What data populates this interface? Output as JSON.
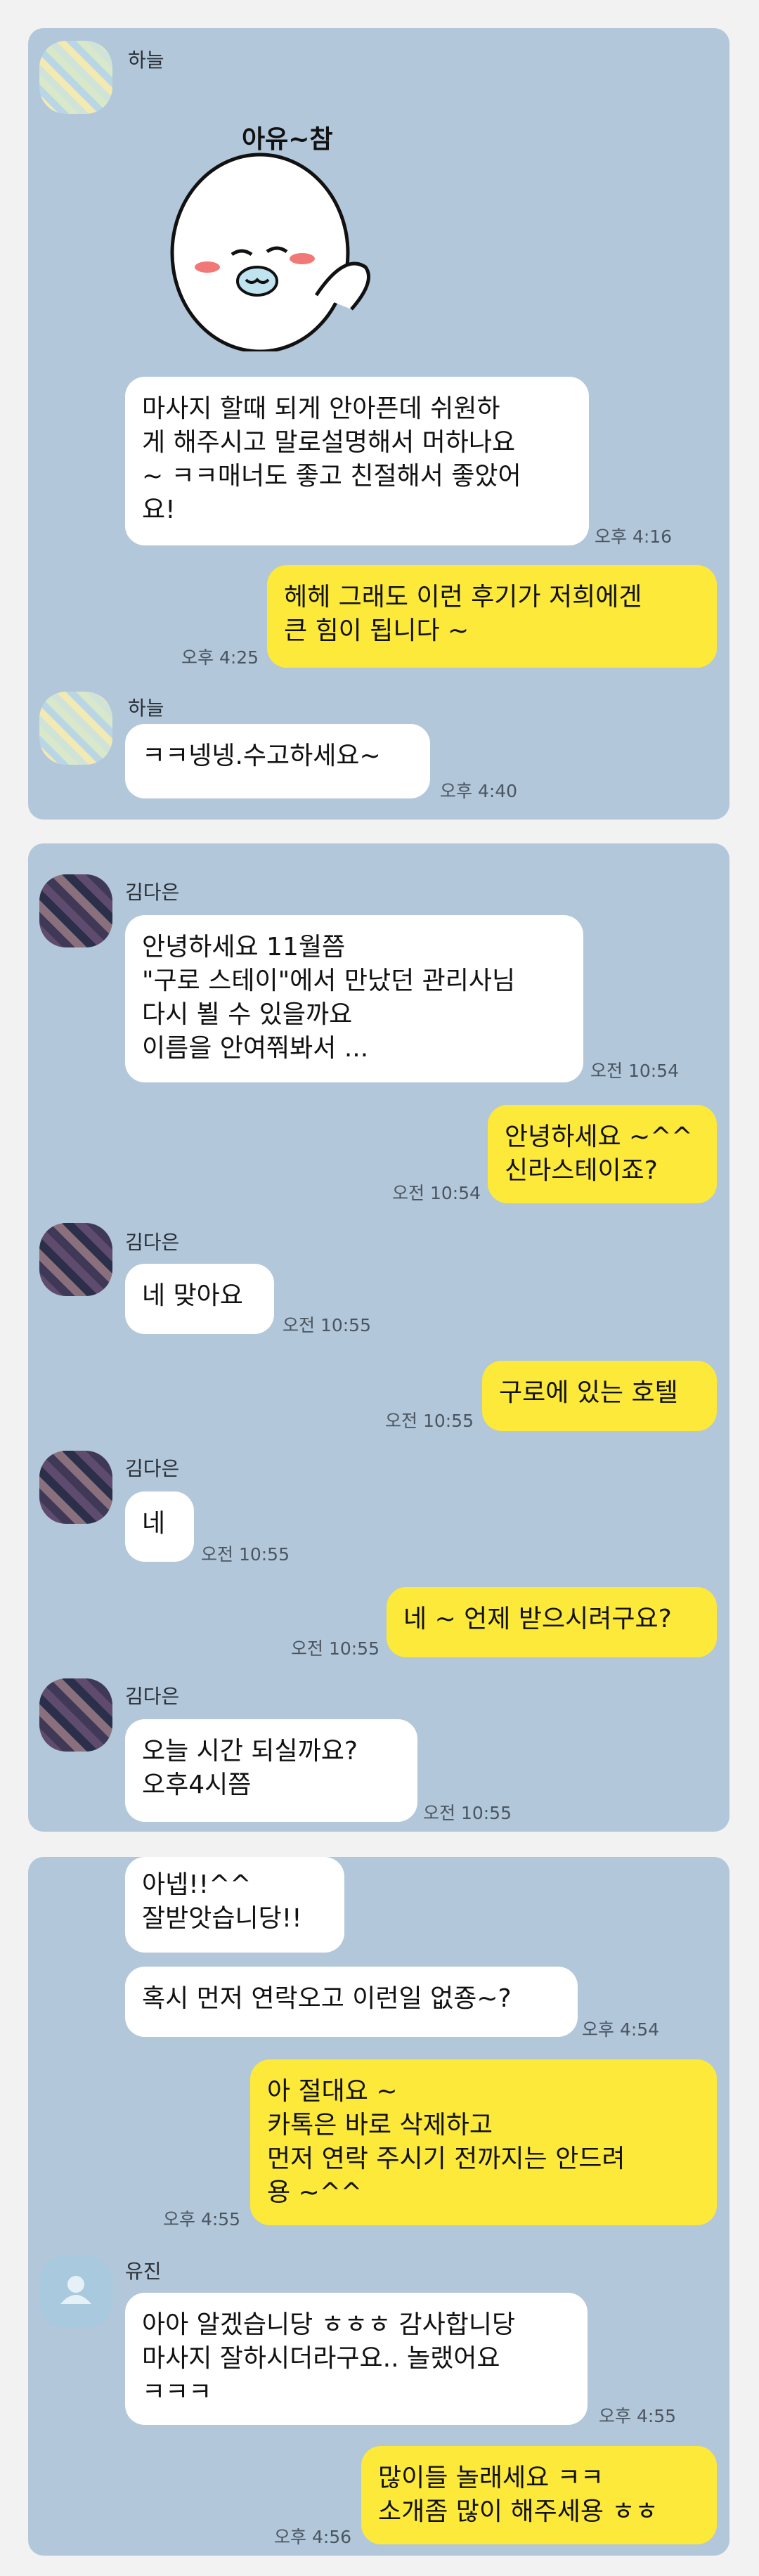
{
  "panel1": {
    "sender1": "하늘",
    "sticker_text": "아유~참",
    "msg1": "마사지 할때 되게 안아픈데 쉬원하\n게 해주시고 말로설명해서 머하나요\n~ ㅋㅋ매너도 좋고 친절해서 좋았어\n요!",
    "time1": "오후 4:16",
    "reply1": "헤헤 그래도 이런 후기가 저희에겐\n큰 힘이 됩니다 ~",
    "time2": "오후 4:25",
    "sender2": "하늘",
    "msg2": "ㅋㅋ넹넹.수고하세요~",
    "time3": "오후 4:40"
  },
  "panel2": {
    "sender": "김다은",
    "msg1": "안녕하세요 11월쯤\n\"구로 스테이\"에서 만났던 관리사님\n다시 뵐 수 있을까요\n이름을 안여쭤봐서 ...",
    "time1": "오전 10:54",
    "reply1": "안녕하세요 ~^^\n신라스테이죠?",
    "time2": "오전 10:54",
    "msg2": "네 맞아요",
    "time3": "오전 10:55",
    "reply2": "구로에 있는 호텔",
    "time4": "오전 10:55",
    "msg3": "네",
    "time5": "오전 10:55",
    "reply3": "네 ~ 언제 받으시려구요?",
    "time6": "오전 10:55",
    "msg4": "오늘  시간 되실까요?\n오후4시쯤",
    "time7": "오전 10:55"
  },
  "panel3": {
    "msg1": "아넵!!^^\n잘받앗습니당!!",
    "msg2": "혹시 먼저 연락오고 이런일 없죵~?",
    "time1": "오후 4:54",
    "reply1": "아 절대요 ~\n카톡은 바로 삭제하고\n먼저 연락 주시기 전까지는 안드려\n용 ~^^",
    "time2": "오후 4:55",
    "sender": "유진",
    "msg3": "아아 알겠습니당 ㅎㅎㅎ 감사합니당\n마사지 잘하시더라구요.. 놀랬어요\nㅋㅋㅋ",
    "time3": "오후 4:55",
    "reply2": "많이들 놀래세요 ㅋㅋ\n소개좀 많이 해주세용 ㅎㅎ",
    "time4": "오후 4:56"
  },
  "colors": {
    "chat_bg": "#b2c7da",
    "incoming": "#ffffff",
    "outgoing": "#fce93a"
  }
}
